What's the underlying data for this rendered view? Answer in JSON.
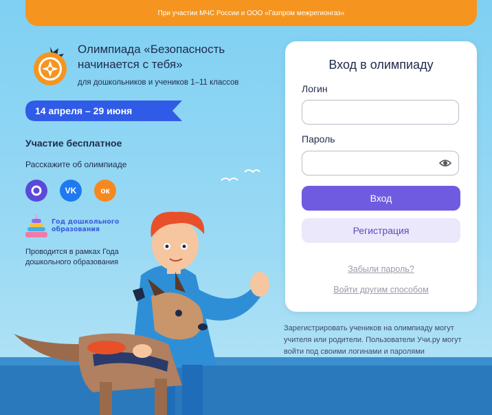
{
  "banner": {
    "text": "При участии МЧС России и ООО «Газпром межрегионгаз»"
  },
  "promo": {
    "title": "Олимпиада «Безопасность начинается с тебя»",
    "subtitle": "для дошкольников и учеников 1–11 классов",
    "dates": "14 апреля – 29 июня",
    "free": "Участие бесплатное",
    "share": "Расскажите об олимпиаде",
    "social": [
      {
        "name": "max",
        "icon": "max-icon",
        "color": "#5a4ad8"
      },
      {
        "name": "vk",
        "icon": "vk-icon",
        "label": "VK",
        "color": "#1f7af0"
      },
      {
        "name": "ok",
        "icon": "ok-icon",
        "label": "ок",
        "color": "#f5891f"
      }
    ],
    "year_logo_text": "Год дошкольного образования",
    "held": "Проводится в рамках Года дошкольного образования"
  },
  "login": {
    "heading": "Вход в олимпиаду",
    "login_label": "Логин",
    "login_value": "",
    "password_label": "Пароль",
    "password_value": "",
    "submit": "Вход",
    "register": "Регистрация",
    "forgot": "Забыли пароль?",
    "other_way": "Войти другим способом"
  },
  "note": "Зарегистрировать учеников на олимпиаду могут учителя или родители. Пользователи Учи.ру могут войти под своими логинами и паролями",
  "colors": {
    "accent": "#6f5be0",
    "banner": "#f5951f",
    "date_ribbon": "#2f5be6"
  }
}
